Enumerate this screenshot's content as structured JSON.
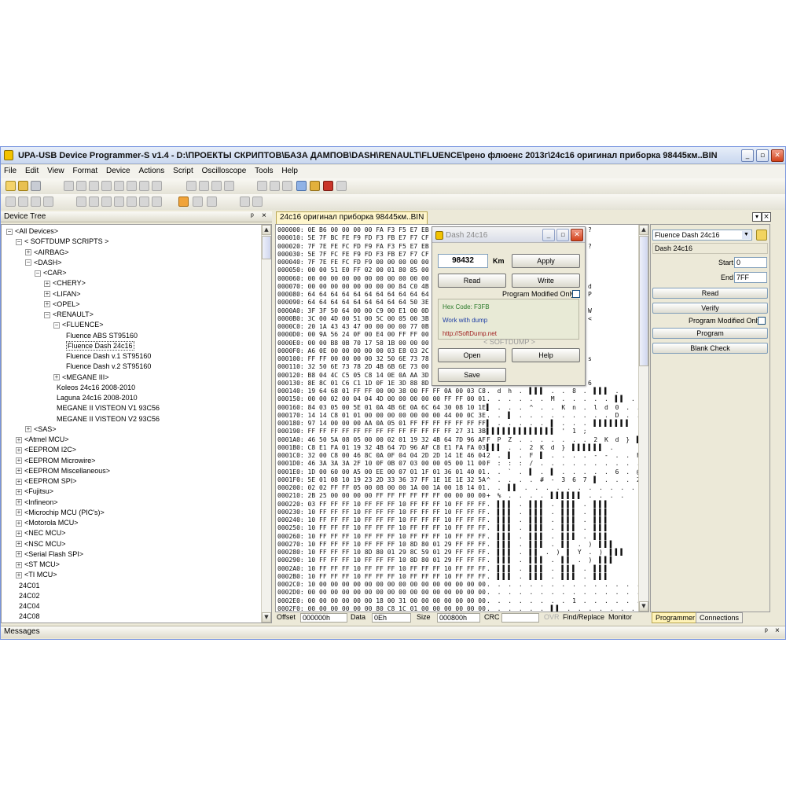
{
  "window": {
    "title": "UPA-USB Device Programmer-S v1.4 - D:\\ПРОЕКТЫ СКРИПТОВ\\БАЗА ДАМПОВ\\DASH\\RENAULT\\FLUENCE\\рено флюенс 2013г\\24с16 оригинал приборка  98445км..BIN",
    "controls": {
      "minimize": "_",
      "maximize": "▫",
      "close": "✕"
    }
  },
  "menu": [
    "File",
    "Edit",
    "View",
    "Format",
    "Device",
    "Actions",
    "Script",
    "Oscilloscope",
    "Tools",
    "Help"
  ],
  "device_tree": {
    "title": "Device Tree",
    "pin": "ᵖ",
    "close": "×",
    "items": [
      {
        "label": "<All Devices>",
        "glyph": "−"
      },
      {
        "label": "< SOFTDUMP SCRIPTS >",
        "glyph": "−"
      },
      {
        "label": "<AIRBAG>",
        "glyph": "+"
      },
      {
        "label": "<DASH>",
        "glyph": "−"
      },
      {
        "label": "<CAR>",
        "glyph": "−"
      },
      {
        "label": "<CHERY>",
        "glyph": "+"
      },
      {
        "label": "<LIFAN>",
        "glyph": "+"
      },
      {
        "label": "<OPEL>",
        "glyph": "+"
      },
      {
        "label": "<RENAULT>",
        "glyph": "−"
      },
      {
        "label": "<FLUENCE>",
        "glyph": "−"
      },
      {
        "label": "Fluence ABS ST95160",
        "glyph": ""
      },
      {
        "label": "Fluence Dash 24c16",
        "glyph": ""
      },
      {
        "label": "Fluence Dash v.1 ST95160",
        "glyph": ""
      },
      {
        "label": "Fluence Dash v.2 ST95160",
        "glyph": ""
      },
      {
        "label": "<MEGANE III>",
        "glyph": "+"
      },
      {
        "label": "Koleos 24c16 2008-2010",
        "glyph": ""
      },
      {
        "label": "Laguna 24c16 2008-2010",
        "glyph": ""
      },
      {
        "label": "MEGANE II VISTEON V1 93C56",
        "glyph": ""
      },
      {
        "label": "MEGANE II VISTEON V2 93C56",
        "glyph": ""
      },
      {
        "label": "<SAS>",
        "glyph": "+"
      },
      {
        "label": "<Atmel MCU>",
        "glyph": "+"
      },
      {
        "label": "<EEPROM I2C>",
        "glyph": "+"
      },
      {
        "label": "<EEPROM Microwire>",
        "glyph": "+"
      },
      {
        "label": "<EEPROM Miscellaneous>",
        "glyph": "+"
      },
      {
        "label": "<EEPROM SPI>",
        "glyph": "+"
      },
      {
        "label": "<Fujitsu>",
        "glyph": "+"
      },
      {
        "label": "<Infineon>",
        "glyph": "+"
      },
      {
        "label": "<Microchip MCU (PIC's)>",
        "glyph": "+"
      },
      {
        "label": "<Motorola MCU>",
        "glyph": "+"
      },
      {
        "label": "<NEC MCU>",
        "glyph": "+"
      },
      {
        "label": "<NSC MCU>",
        "glyph": "+"
      },
      {
        "label": "<Serial Flash SPI>",
        "glyph": "+"
      },
      {
        "label": "<ST MCU>",
        "glyph": "+"
      },
      {
        "label": "<TI MCU>",
        "glyph": "+"
      },
      {
        "label": "24C01",
        "glyph": ""
      },
      {
        "label": "24C02",
        "glyph": ""
      },
      {
        "label": "24C04",
        "glyph": ""
      },
      {
        "label": "24C08",
        "glyph": ""
      }
    ]
  },
  "doc_tab": "24с16 оригинал приборка  98445км..BIN",
  "hex": {
    "rows": [
      [
        "000000:",
        "0E B6 00 00 00 00 FA F3 F5 E7 EB C",
        "?"
      ],
      [
        "000010:",
        "5E 7F BC FE F9 FD F3 FB E7 F7 CF E",
        ""
      ],
      [
        "000020:",
        "7F 7E FE FC FD F9 FA F3 F5 E7 EB C",
        "?"
      ],
      [
        "000030:",
        "5E 7F FC FE F9 FD F3 FB E7 F7 CF E",
        ""
      ],
      [
        "000040:",
        "7F 7E FE FC FD F9 00 00 00 00 00 0",
        ""
      ],
      [
        "000050:",
        "00 00 51 E0 FF 02 00 01 80 85 00 0",
        ""
      ],
      [
        "000060:",
        "00 00 00 00 00 00 00 00 00 00 00 0",
        ""
      ],
      [
        "000070:",
        "00 00 00 00 00 00 00 00 84 C0 4B C",
        "d"
      ],
      [
        "000080:",
        "64 64 64 64 64 64 64 64 64 64 64 6",
        "P"
      ],
      [
        "000090:",
        "64 64 64 64 64 64 64 64 64 50 3E 5",
        ""
      ],
      [
        "0000A0:",
        "3F 3F 50 64 00 00 C9 00 E1 00 0D C",
        "W"
      ],
      [
        "0000B0:",
        "3C 00 4D 00 51 00 5C 00 05 00 3B 2",
        "<"
      ],
      [
        "0000C0:",
        "20 1A 43 43 47 00 00 00 00 77 0B C",
        ""
      ],
      [
        "0000D0:",
        "00 9A 56 24 0F 00 E4 00 FF FF 00 0",
        ""
      ],
      [
        "0000E0:",
        "00 00 B8 0B 70 17 58 1B 00 00 00 0",
        ""
      ],
      [
        "0000F0:",
        "A6 0E 00 00 00 00 00 03 E8 03 2C 0",
        ""
      ],
      [
        "000100:",
        "FF FF 00 00 00 00 32 50 6E 73 78 2",
        "s"
      ],
      [
        "000110:",
        "32 50 6E 73 78 2D 4B 6B 6E 73 00 0",
        ""
      ],
      [
        "000120:",
        "B8 04 4C C5 05 C8 14 0E 0A AA 3D 0",
        ""
      ],
      [
        "000130:",
        "8E 8C 01 C6 C1 1D 0F 1E 3D 88 8D 0",
        "6"
      ],
      [
        "000140:",
        "19 64 68 01 FF FF 00 00 38 00 FF FF 0A 00 03 C8",
        ". d h . ▌▌▌ . . 8 . ▌▌▌ ."
      ],
      [
        "000150:",
        "00 00 02 00 04 04 4D 00 00 00 00 00 FF FF 00 01",
        ". . . . . . M . . . . . ▌▌ ."
      ],
      [
        "000160:",
        "84 03 05 00 5E 01 0A 4B 6E 0A 6C 64 30 08 10 1E",
        "▌ . . . ^ . . K n . l d 0 . ."
      ],
      [
        "000170:",
        "14 14 C8 01 01 00 00 00 00 00 00 00 44 00 0C 3E",
        ". . ▌ . . . . . . . . . D . . >"
      ],
      [
        "000180:",
        "97 14 00 00 00 AA 0A 05 01 FF FF FF FF FF FF FF",
        "▌ . . . . . ▌ . . . ▌▌▌▌▌▌▌"
      ],
      [
        "000190:",
        "FF FF FF FF FF FF FF FF FF FF FF FF FF 27 31 3B",
        "▌▌▌▌▌▌▌▌▌▌▌▌▌ ' 1 ;"
      ],
      [
        "0001A0:",
        "46 50 5A 08 05 00 00 02 01 19 32 4B 64 7D 96 AF",
        "F P Z . . . . . . . 2 K d } ▌▌"
      ],
      [
        "0001B0:",
        "C8 E1 FA 01 19 32 4B 64 7D 96 AF C8 E1 FA FA 03",
        "▌▌▌ . . 2 K d } ▌▌▌▌▌▌ ."
      ],
      [
        "0001C0:",
        "32 00 C8 00 46 8C 0A 0F 04 04 2D 2D 14 1E 46 04",
        "2 . ▌ . F ▌ . . . . - - . . F ."
      ],
      [
        "0001D0:",
        "46 3A 3A 3A 2F 10 0F 0B 07 03 00 00 05 00 11 00",
        "F : : : / . . . . . . . . . . ."
      ],
      [
        "0001E0:",
        "1D 00 60 00 A5 00 EE 00 07 01 1F 01 36 01 40 01",
        ". . ` . ▌ . ▌ . . . . . 6 . @ ."
      ],
      [
        "0001F0:",
        "5E 01 08 10 19 23 2D 33 36 37 FF 1E 1E 1E 32 5A",
        "^ . . . . # - 3 6 7 ▌ . . . 2 Z"
      ],
      [
        "000200:",
        "02 02 FF FF 05 00 08 00 00 1A 00 1A 00 18 14 01",
        ". . ▌▌ . . . . . . . . . . . ."
      ],
      [
        "000210:",
        "2B 25 00 00 00 00 FF FF FF FF FF FF 00 00 00 00",
        "+ % . . . . ▌▌▌▌▌▌ . . . ."
      ],
      [
        "000220:",
        "03 FF FF FF 10 FF FF FF 10 FF FF FF 10 FF FF FF",
        ". ▌▌▌ . ▌▌▌ . ▌▌▌ . ▌▌▌"
      ],
      [
        "000230:",
        "10 FF FF FF 10 FF FF FF 10 FF FF FF 10 FF FF FF",
        ". ▌▌▌ . ▌▌▌ . ▌▌▌ . ▌▌▌"
      ],
      [
        "000240:",
        "10 FF FF FF 10 FF FF FF 10 FF FF FF 10 FF FF FF",
        ". ▌▌▌ . ▌▌▌ . ▌▌▌ . ▌▌▌"
      ],
      [
        "000250:",
        "10 FF FF FF 10 FF FF FF 10 FF FF FF 10 FF FF FF",
        ". ▌▌▌ . ▌▌▌ . ▌▌▌ . ▌▌▌"
      ],
      [
        "000260:",
        "10 FF FF FF 10 FF FF FF 10 FF FF FF 10 FF FF FF",
        ". ▌▌▌ . ▌▌▌ . ▌▌▌ . ▌▌▌"
      ],
      [
        "000270:",
        "10 FF FF FF 10 FF FF FF 10 8D 80 01 29 FF FF FF",
        ". ▌▌▌ . ▌▌▌ . ▌▌ . ) ▌▌▌"
      ],
      [
        "000280:",
        "10 FF FF FF 10 8D 80 01 29 8C 59 01 29 FF FF FF",
        ". ▌▌▌ . ▌▌ . ) ▌ Y . ) ▌▌▌"
      ],
      [
        "000290:",
        "10 FF FF FF 10 FF FF FF 10 8D 80 01 29 FF FF FF",
        ". ▌▌▌ . ▌▌▌ . ▌▌ . ) ▌▌▌"
      ],
      [
        "0002A0:",
        "10 FF FF FF 10 FF FF FF 10 FF FF FF 10 FF FF FF",
        ". ▌▌▌ . ▌▌▌ . ▌▌▌ . ▌▌▌"
      ],
      [
        "0002B0:",
        "10 FF FF FF 10 FF FF FF 10 FF FF FF 10 FF FF FF",
        ". ▌▌▌ . ▌▌▌ . ▌▌▌ . ▌▌▌"
      ],
      [
        "0002C0:",
        "10 00 00 00 00 00 00 00 00 00 00 00 00 00 00 00",
        ". . . . . . . . . . . . . . . ."
      ],
      [
        "0002D0:",
        "00 00 00 00 00 00 00 00 00 00 00 00 00 00 00 00",
        ". . . . . . . . . . . . . . . ."
      ],
      [
        "0002E0:",
        "00 00 00 00 00 00 18 00 31 00 00 00 00 00 00 00",
        ". . . . . . . . 1 . . . . . . ."
      ],
      [
        "0002F0:",
        "00 00 00 00 00 00 80 C8 1C 01 00 00 00 00 00 00",
        ". . . . . . ▌▌ . . . . . . . ."
      ]
    ]
  },
  "status": {
    "offset_label": "Offset",
    "offset_value": "000000h",
    "data_label": "Data",
    "data_value": "0Eh",
    "size_label": "Size",
    "size_value": "000800h",
    "crc_label": "CRC",
    "crc_value": "",
    "ovr": "OVR",
    "find_replace": "Find/Replace",
    "monitor": "Monitor"
  },
  "dialog": {
    "title": "Dash 24c16",
    "km_value": "98432",
    "km_unit": "Km",
    "apply": "Apply",
    "read": "Read",
    "write": "Write",
    "modified_label": "Program Modified Only",
    "hex_code": "Hex Code: F3FB",
    "work": "Work with dump",
    "url": "http://SoftDump.net",
    "brand": "< SOFTDUMP >",
    "open": "Open",
    "help": "Help",
    "save": "Save"
  },
  "right_panel": {
    "device_select": "Fluence Dash 24c16",
    "device_name": "Dash 24c16",
    "start_label": "Start",
    "start_value": "0",
    "end_label": "End",
    "end_value": "7FF",
    "read": "Read",
    "verify": "Verify",
    "modified_label": "Program Modified Only",
    "program": "Program",
    "blank_check": "Blank Check",
    "tab_programmer": "Programmer",
    "tab_connections": "Connections"
  },
  "messages": {
    "title": "Messages",
    "pin": "ᵖ",
    "close": "×"
  },
  "colors": {
    "accent": "#ece9d8",
    "doc_tab": "#fff6cc",
    "close": "#d3421c",
    "dialog_info_green": "#2a7a2a",
    "dialog_info_blue": "#1f3fa6",
    "dialog_info_red": "#a12020"
  }
}
